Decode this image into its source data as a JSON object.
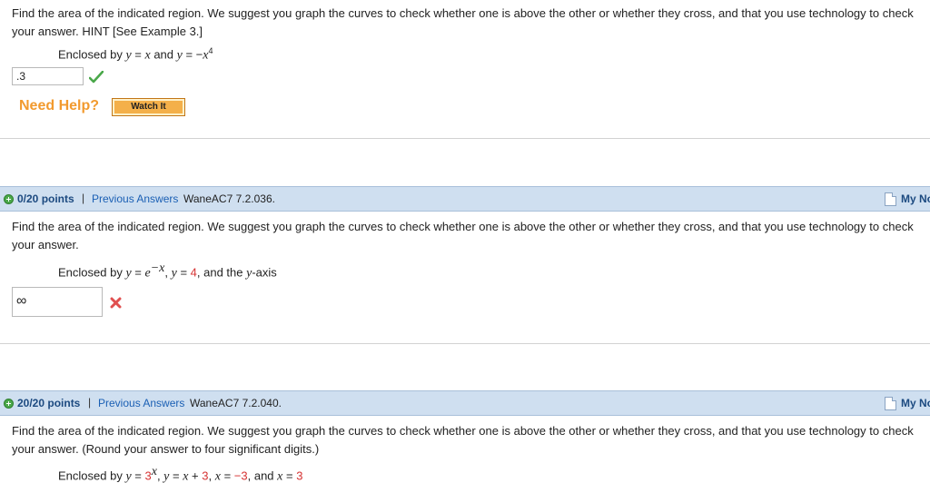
{
  "q1": {
    "text": "Find the area of the indicated region. We suggest you graph the curves to check whether one is above the other or whether they cross, and that you use technology to check your answer. HINT [See Example 3.]",
    "enclosed_prefix": "Enclosed by ",
    "y1_var": "y",
    "y1_eq": " = ",
    "y1_rhs": "x",
    "and": " and ",
    "y2_var": "y",
    "y2_eq": " = −",
    "y2_rhs": "x",
    "y2_exp": "4",
    "answer": ".3",
    "status_icon": "check-icon",
    "need_help": "Need Help?",
    "watch_it": "Watch It"
  },
  "q2": {
    "points": "0/20 points",
    "sep": "|",
    "previous_answers": "Previous Answers",
    "code": "WaneAC7 7.2.036.",
    "my_notes": "My Notes",
    "text": "Find the area of the indicated region. We suggest you graph the curves to check whether one is above the other or whether they cross, and that you use technology to check your answer.",
    "enclosed_prefix": "Enclosed by ",
    "y_var": "y",
    "eq1": " = ",
    "e_base": "e",
    "e_exp": "−x",
    "comma1": ", ",
    "y2_var": "y",
    "eq2": " = ",
    "val": "4",
    "tail": ", and the ",
    "yaxis_var": "y",
    "tail2": "-axis",
    "answer": "∞",
    "status_icon": "cross-icon"
  },
  "q3": {
    "points": "20/20 points",
    "sep": "|",
    "previous_answers": "Previous Answers",
    "code": "WaneAC7 7.2.040.",
    "my_notes": "My Notes",
    "text": "Find the area of the indicated region. We suggest you graph the curves to check whether one is above the other or whether they cross, and that you use technology to check your answer. (Round your answer to four significant digits.)",
    "enclosed_prefix": "Enclosed by ",
    "y_var": "y",
    "eq1": " = ",
    "base3": "3",
    "exp_x": "x",
    "c1": ", ",
    "y2_var": "y",
    "eq2": " = ",
    "x_var": "x",
    "plus": " + ",
    "three": "3",
    "c2": ", ",
    "x2_var": "x",
    "eq3": " = ",
    "neg3": "−3",
    "c3": ", and ",
    "x3_var": "x",
    "eq4": " = ",
    "three2": "3"
  },
  "colors": {
    "header_bg": "#cfdff0",
    "link": "#1a5fb4",
    "help_orange": "#f29a2e",
    "button_orange": "#f4b04a",
    "correct_green": "#4aa84a",
    "wrong_red": "#e05050",
    "value_red": "#d63333"
  }
}
